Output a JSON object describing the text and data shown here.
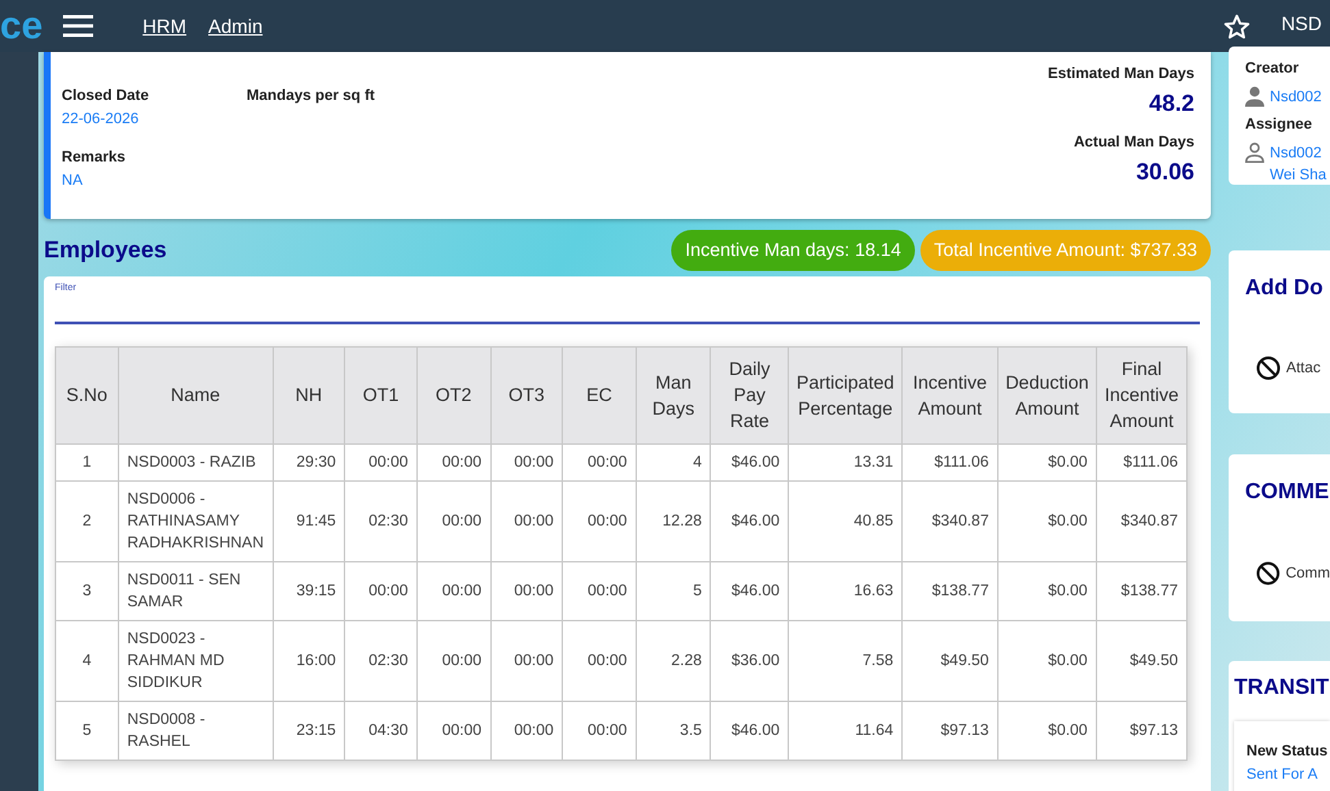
{
  "topbar": {
    "logo": "ce",
    "menu": [
      "HRM",
      "Admin"
    ],
    "user": "NSD"
  },
  "details": {
    "fields": [
      {
        "label": "Closed Date",
        "value": "22-06-2026"
      },
      {
        "label": "Mandays per sq ft"
      },
      {
        "label": "Remarks",
        "value": "NA"
      }
    ],
    "totals": [
      {
        "label": "Estimated Man Days",
        "value": "48.2"
      },
      {
        "label": "Actual Man Days",
        "value": "30.06"
      }
    ]
  },
  "employees": {
    "title": "Employees",
    "badges": [
      {
        "text": "Incentive Man days: 18.14",
        "color": "#43ac10"
      },
      {
        "text": "Total Incentive Amount: $737.33",
        "color": "#ebae08"
      }
    ],
    "filter": {
      "label": "Filter"
    },
    "table": {
      "columns": [
        "S.No",
        "Name",
        "NH",
        "OT1",
        "OT2",
        "OT3",
        "EC",
        "Man Days",
        "Daily Pay Rate",
        "Participated Percentage",
        "Incentive Amount",
        "Deduction Amount",
        "Final Incentive Amount"
      ],
      "rows": [
        [
          "1",
          "NSD0003 - RAZIB",
          "29:30",
          "00:00",
          "00:00",
          "00:00",
          "00:00",
          "4",
          "$46.00",
          "13.31",
          "$111.06",
          "$0.00",
          "$111.06"
        ],
        [
          "2",
          "NSD0006 - RATHINASAMY RADHAKRISHNAN",
          "91:45",
          "02:30",
          "00:00",
          "00:00",
          "00:00",
          "12.28",
          "$46.00",
          "40.85",
          "$340.87",
          "$0.00",
          "$340.87"
        ],
        [
          "3",
          "NSD0011 - SEN SAMAR",
          "39:15",
          "00:00",
          "00:00",
          "00:00",
          "00:00",
          "5",
          "$46.00",
          "16.63",
          "$138.77",
          "$0.00",
          "$138.77"
        ],
        [
          "4",
          "NSD0023 - RAHMAN MD SIDDIKUR",
          "16:00",
          "02:30",
          "00:00",
          "00:00",
          "00:00",
          "2.28",
          "$36.00",
          "7.58",
          "$49.50",
          "$0.00",
          "$49.50"
        ],
        [
          "5",
          "NSD0008 - RASHEL",
          "23:15",
          "04:30",
          "00:00",
          "00:00",
          "00:00",
          "3.5",
          "$46.00",
          "11.64",
          "$97.13",
          "$0.00",
          "$97.13"
        ]
      ]
    }
  },
  "side": {
    "people": [
      {
        "role": "Creator",
        "kind": "filled",
        "lines": [
          "Nsd002"
        ]
      },
      {
        "role": "Assignee",
        "kind": "outline",
        "lines": [
          "Nsd002",
          "Wei Sha"
        ]
      }
    ],
    "documents": {
      "title": "Add Do",
      "note": "Attac"
    },
    "comments": {
      "title": "COMME",
      "note": "Comm"
    },
    "transitions": {
      "title": "TRANSIT",
      "label": "New Status",
      "value": "Sent For A"
    }
  }
}
